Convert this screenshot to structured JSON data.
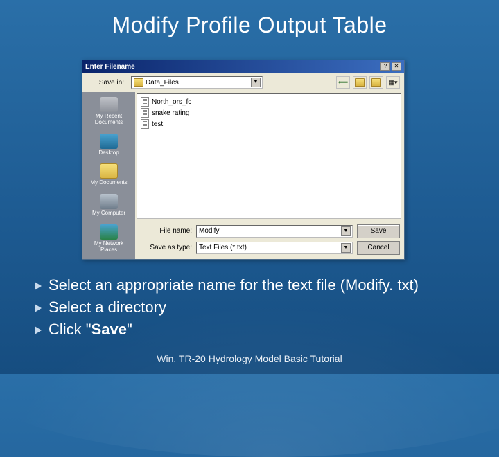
{
  "slide": {
    "title": "Modify Profile Output Table"
  },
  "dialog": {
    "title": "Enter Filename",
    "savein_label": "Save in:",
    "savein_value": "Data_Files",
    "places": {
      "recent": "My Recent Documents",
      "desktop": "Desktop",
      "docs": "My Documents",
      "computer": "My Computer",
      "network": "My Network Places"
    },
    "files": {
      "0": "North_ors_fc",
      "1": "snake rating",
      "2": "test"
    },
    "filename_label": "File name:",
    "filename_value": "Modify",
    "saveas_label": "Save as type:",
    "saveas_value": "Text Files (*.txt)",
    "save_btn": "Save",
    "cancel_btn": "Cancel"
  },
  "bullets": {
    "0": "Select an appropriate name for the text file (Modify. txt)",
    "1": "Select a directory",
    "2_prefix": "Click \"",
    "2_bold": "Save",
    "2_suffix": "\""
  },
  "footer": "Win. TR-20 Hydrology Model Basic Tutorial"
}
